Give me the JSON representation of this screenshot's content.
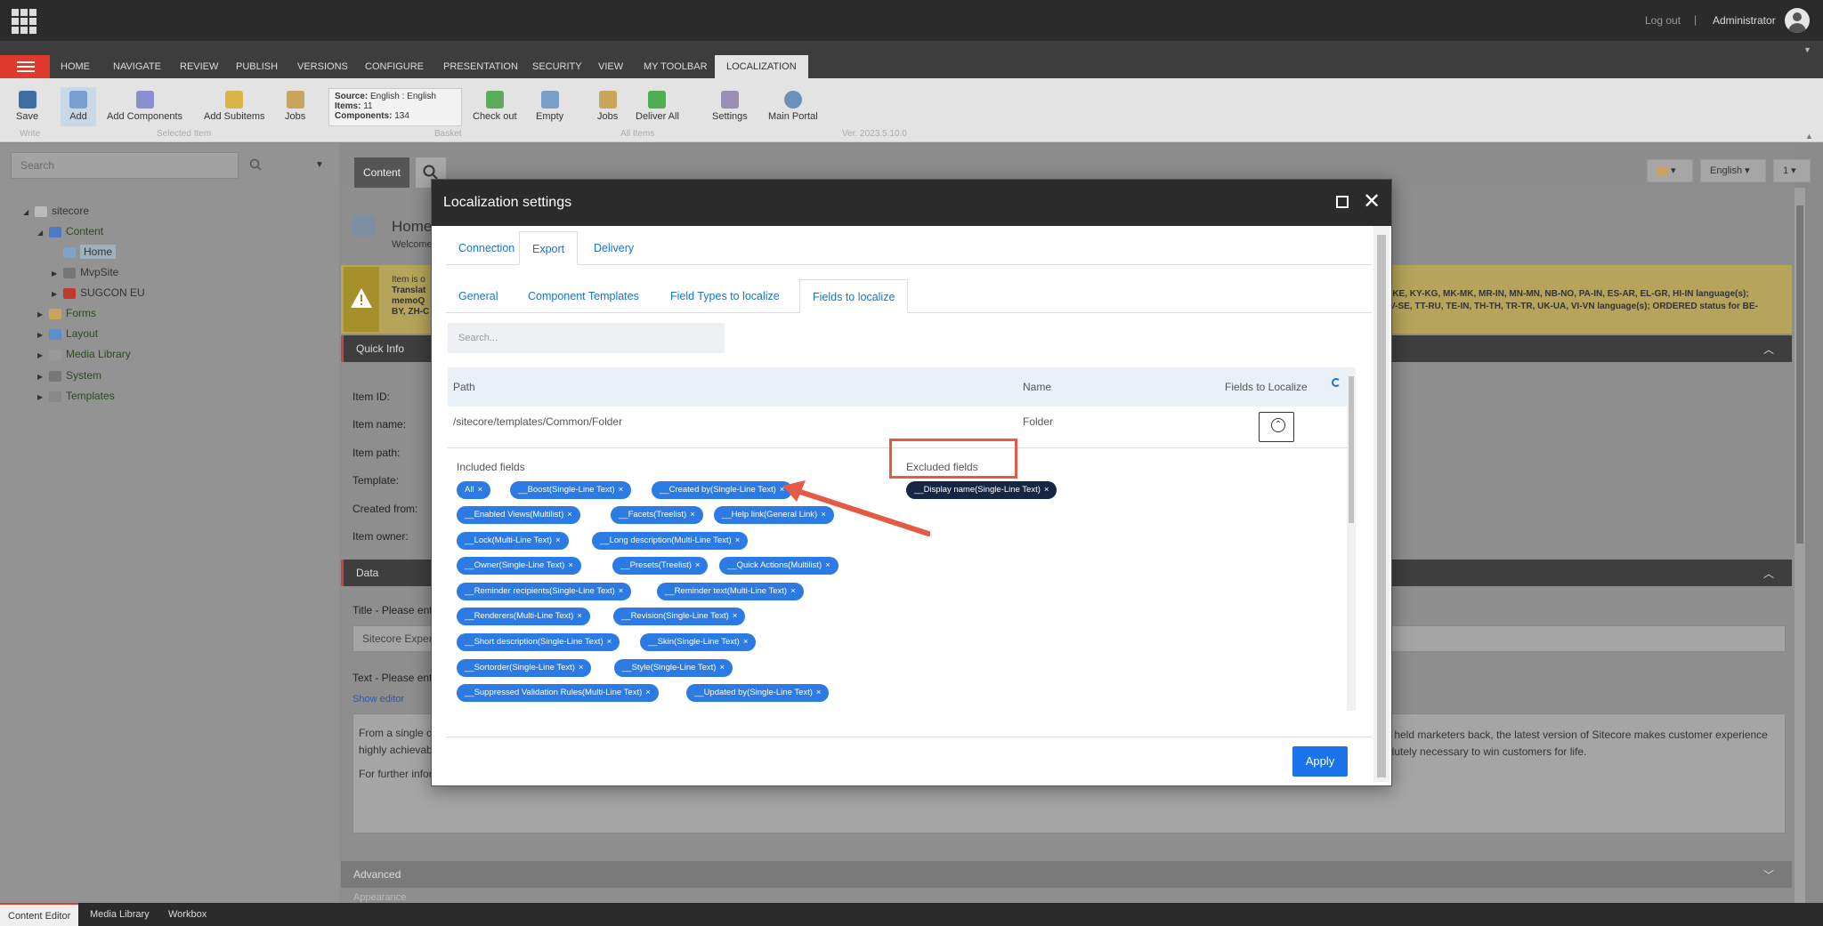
{
  "header": {
    "logout": "Log out",
    "separator": "|",
    "user": "Administrator"
  },
  "ribbon_tabs": [
    "HOME",
    "NAVIGATE",
    "REVIEW",
    "PUBLISH",
    "VERSIONS",
    "CONFIGURE",
    "PRESENTATION",
    "SECURITY",
    "VIEW",
    "MY TOOLBAR",
    "LOCALIZATION"
  ],
  "ribbon": {
    "buttons": [
      "Save",
      "Add",
      "Add Components",
      "Add Subitems",
      "Jobs",
      "Check out",
      "Empty",
      "Jobs",
      "Deliver All",
      "Settings",
      "Main Portal"
    ],
    "groups": [
      "Write",
      "Selected Item",
      "Basket",
      "All Items"
    ],
    "basket_source_label": "Source:",
    "basket_source": "English : English",
    "basket_items_label": "Items:",
    "basket_items": "11",
    "basket_components_label": "Components:",
    "basket_components": "134",
    "version": "Ver. 2023.5.10.0"
  },
  "left": {
    "search_placeholder": "Search",
    "tree": [
      "sitecore",
      "Content",
      "Home",
      "MvpSite",
      "SUGCON EU",
      "Forms",
      "Layout",
      "Media Library",
      "System",
      "Templates"
    ]
  },
  "content": {
    "tab_content": "Content",
    "language": "English",
    "version_btn": "1",
    "home_title": "Home",
    "welcome": "Welcome",
    "warn_1": "Item is o",
    "warn_2": "Translat",
    "warn_3": "memoQ",
    "warn_4": "BY, ZH-C",
    "warn_right_1": "-KE, KY-KG, MK-MK, MR-IN, MN-MN, NB-NO, PA-IN, ES-AR, EL-GR, HI-IN language(s);",
    "warn_right_2": "V-SE, TT-RU, TE-IN, TH-TH, TR-TR, UK-UA, VI-VN language(s); ORDERED status for BE-",
    "quick_info": "Quick Info",
    "info_labels": [
      "Item ID:",
      "Item name:",
      "Item path:",
      "Template:",
      "Created from:",
      "Item owner:"
    ],
    "data_section": "Data",
    "title_label": "Title - Please ente",
    "title_value": "Sitecore Experi",
    "text_label": "Text - Please ente",
    "show_editor": "Show editor",
    "text_left_1": "From a single co",
    "text_left_2": "highly achievable",
    "text_left_3": "For further infor",
    "text_right_1": "y held marketers back, the latest version of Sitecore makes customer experience",
    "text_right_2": "olutely necessary to win customers for life.",
    "advanced": "Advanced",
    "appearance": "Appearance"
  },
  "bottom_tabs": [
    "Content Editor",
    "Media Library",
    "Workbox"
  ],
  "modal": {
    "title": "Localization settings",
    "tabs": [
      "Connection",
      "Export",
      "Delivery"
    ],
    "subtabs": [
      "General",
      "Component Templates",
      "Field Types to localize",
      "Fields to localize"
    ],
    "search_placeholder": "Search...",
    "columns": [
      "Path",
      "Name",
      "Fields to Localize"
    ],
    "row": {
      "path": "/sitecore/templates/Common/Folder",
      "name": "Folder"
    },
    "included_label": "Included fields",
    "excluded_label": "Excluded fields",
    "included": [
      "All",
      "__Boost(Single-Line Text)",
      "__Created by(Single-Line Text)",
      "__Enabled Views(Multilist)",
      "__Facets(Treelist)",
      "__Help link(General Link)",
      "__Lock(Multi-Line Text)",
      "__Long description(Multi-Line Text)",
      "__Owner(Single-Line Text)",
      "__Presets(Treelist)",
      "__Quick Actions(Multilist)",
      "__Reminder recipients(Single-Line Text)",
      "__Reminder text(Multi-Line Text)",
      "__Renderers(Multi-Line Text)",
      "__Revision(Single-Line Text)",
      "__Short description(Single-Line Text)",
      "__Skin(Single-Line Text)",
      "__Sortorder(Single-Line Text)",
      "__Style(Single-Line Text)",
      "__Suppressed Validation Rules(Multi-Line Text)",
      "__Updated by(Single-Line Text)"
    ],
    "excluded": [
      "__Display name(Single-Line Text)"
    ],
    "apply": "Apply",
    "chip_close": "×"
  },
  "colors": {
    "accent": "#1a73e8",
    "chip": "#2c7be5",
    "chip_excluded": "#152744",
    "highlight": "#e55a45",
    "burger": "#e03a2f"
  }
}
